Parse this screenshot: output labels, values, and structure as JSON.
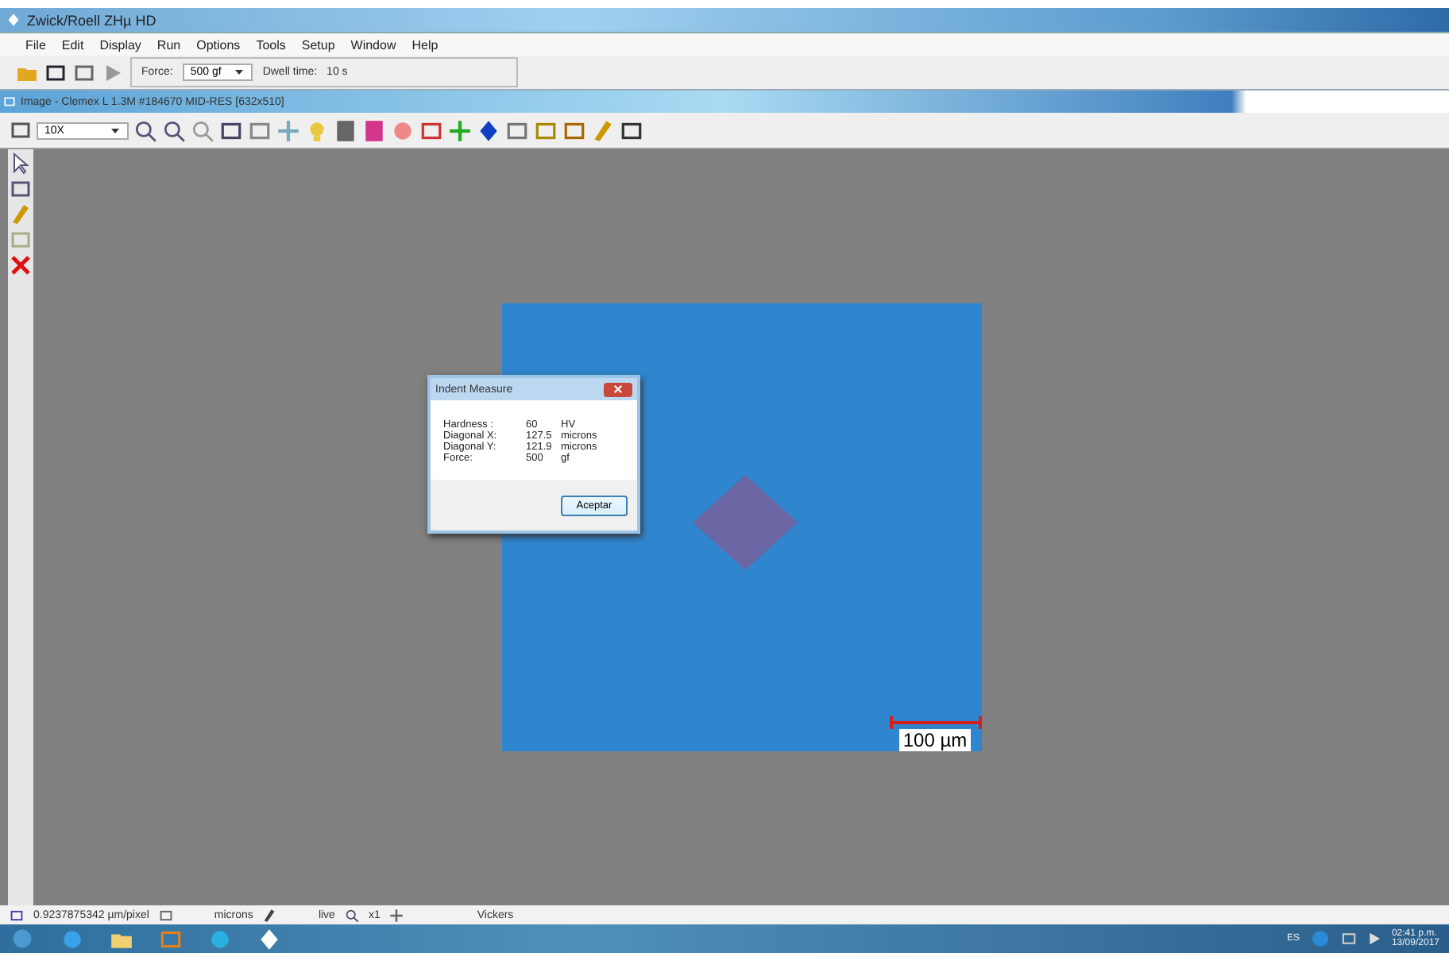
{
  "window": {
    "title": "Zwick/Roell ZHµ HD"
  },
  "menu": [
    "File",
    "Edit",
    "Display",
    "Run",
    "Options",
    "Tools",
    "Setup",
    "Window",
    "Help"
  ],
  "toolbar": {
    "force_label": "Force:",
    "force_value": "500 gf",
    "dwell_label": "Dwell time:",
    "dwell_value": "10 s"
  },
  "image_window": {
    "title": "Image - Clemex L 1.3M #184670 MID-RES [632x510]",
    "magnification": "10X",
    "scale_bar": "100 µm"
  },
  "dialog": {
    "title": "Indent Measure",
    "rows": [
      {
        "label": "Hardness  :",
        "value": "60",
        "unit": "HV"
      },
      {
        "label": "Diagonal X:",
        "value": "127.5",
        "unit": "microns"
      },
      {
        "label": "Diagonal Y:",
        "value": "121.9",
        "unit": "microns"
      },
      {
        "label": "Force:",
        "value": "500",
        "unit": "gf"
      }
    ],
    "button": "Aceptar"
  },
  "status_bar": {
    "calibration": "0.9237875342 µm/pixel",
    "units": "microns",
    "mode": "live",
    "zoom": "x1",
    "method": "Vickers"
  },
  "taskbar": {
    "language": "ES",
    "time": "02:41 p.m.",
    "date": "13/09/2017"
  }
}
